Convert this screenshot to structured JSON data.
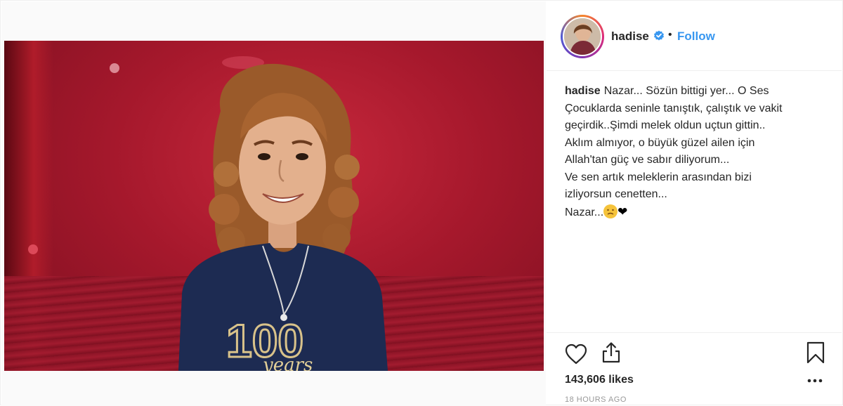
{
  "post": {
    "media": {
      "shirt_number": "100",
      "shirt_script": "years"
    },
    "header": {
      "username": "hadise",
      "separator": "•",
      "follow_label": "Follow"
    },
    "caption": {
      "username": "hadise",
      "lines": [
        "Nazar... Sözün bittigi yer... O Ses",
        "Çocuklarda seninle tanıştık, çalıştık ve vakit",
        "geçirdik..Şimdi melek oldun uçtun gittin..",
        "Aklım almıyor, o büyük güzel ailen için",
        "Allah'tan güç ve sabır diliyorum...",
        "Ve sen artık meleklerin arasından bizi",
        "izliyorsun cenetten...",
        "Nazar..."
      ],
      "end_emoji": "😞",
      "end_heart": "❤"
    },
    "footer": {
      "likes": "143,606 likes",
      "timestamp": "18 HOURS AGO"
    },
    "colors": {
      "accent": "#3897f0",
      "text": "#262626",
      "muted": "#999999",
      "border": "#efefef"
    },
    "icons": [
      "verified-badge-icon",
      "heart-icon",
      "share-icon",
      "bookmark-icon",
      "more-options-icon"
    ]
  }
}
